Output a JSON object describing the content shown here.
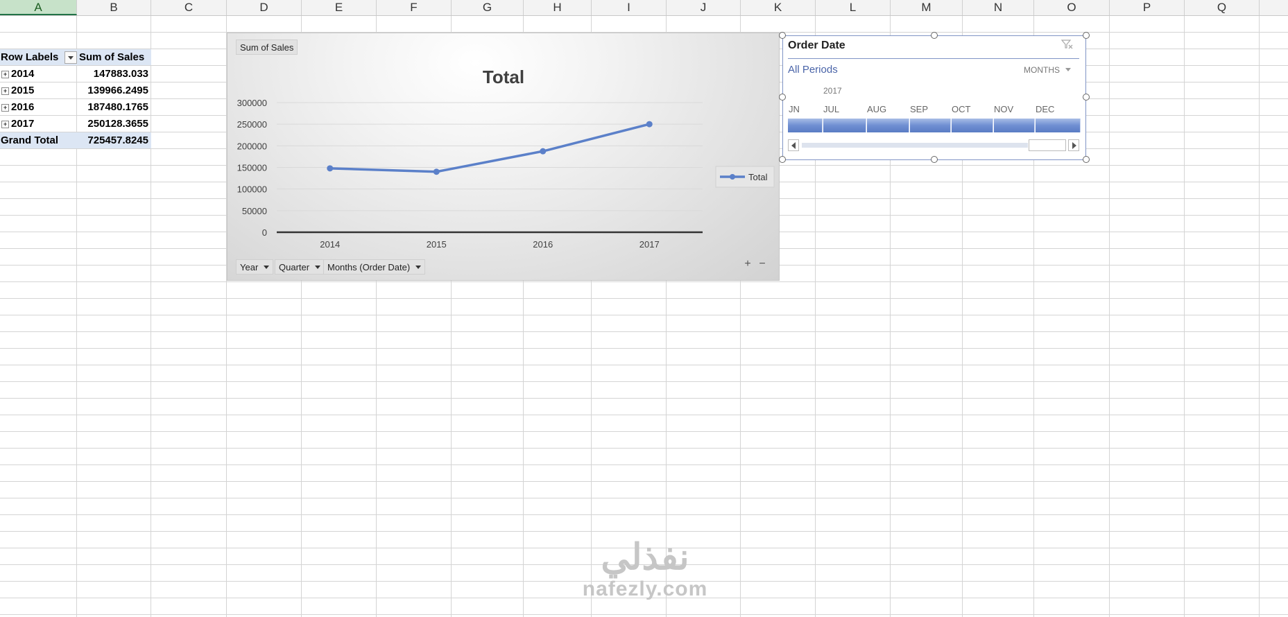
{
  "columns": [
    "A",
    "B",
    "C",
    "D",
    "E",
    "F",
    "G",
    "H",
    "I",
    "J",
    "K",
    "L",
    "M",
    "N",
    "O",
    "P",
    "Q"
  ],
  "active_column": "A",
  "pivot": {
    "header_labels": "Row Labels",
    "header_values": "Sum of Sales",
    "rows": [
      {
        "label": "2014",
        "value": "147883.033"
      },
      {
        "label": "2015",
        "value": "139966.2495"
      },
      {
        "label": "2016",
        "value": "187480.1765"
      },
      {
        "label": "2017",
        "value": "250128.3655"
      }
    ],
    "grand_total_label": "Grand Total",
    "grand_total_value": "725457.8245"
  },
  "chart": {
    "value_field_button": "Sum of Sales",
    "axis_field_buttons": [
      "Year",
      "Quarter",
      "Months (Order Date)"
    ],
    "expand_label": "+",
    "collapse_label": "−"
  },
  "chart_data": {
    "type": "line",
    "title": "Total",
    "categories": [
      "2014",
      "2015",
      "2016",
      "2017"
    ],
    "series": [
      {
        "name": "Total",
        "values": [
          147883.033,
          139966.2495,
          187480.1765,
          250128.3655
        ],
        "color": "#5b80c9"
      }
    ],
    "yticks": [
      0,
      50000,
      100000,
      150000,
      200000,
      250000,
      300000
    ],
    "ylim": [
      0,
      300000
    ],
    "grid": true,
    "legend_position": "right"
  },
  "slicer": {
    "title": "Order Date",
    "all_periods": "All Periods",
    "level": "MONTHS",
    "year": "2017",
    "months": [
      "JN",
      "JUL",
      "AUG",
      "SEP",
      "OCT",
      "NOV",
      "DEC"
    ],
    "accent_color": "#5a7cc4"
  },
  "watermark": {
    "arabic": "نفذلي",
    "latin": "nafezly.com"
  }
}
